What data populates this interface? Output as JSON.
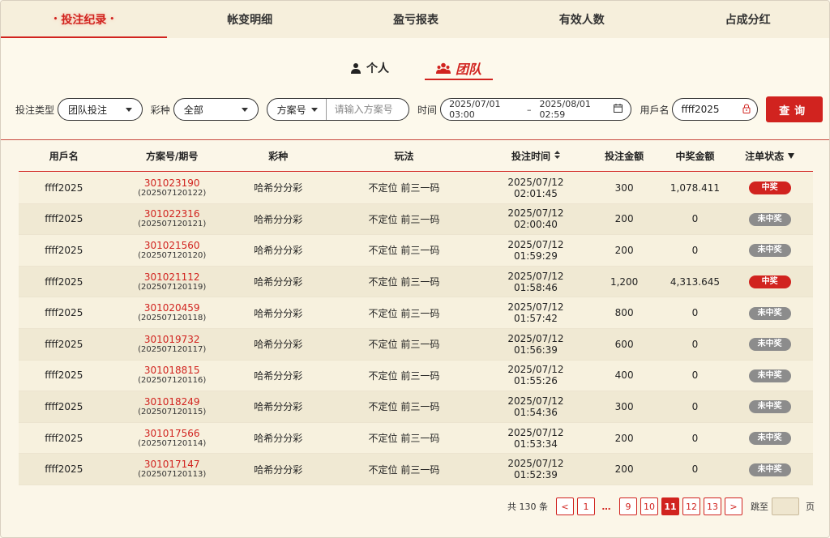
{
  "top_tabs": [
    {
      "label": "投注纪录",
      "active": true
    },
    {
      "label": "帐变明细",
      "active": false
    },
    {
      "label": "盈亏报表",
      "active": false
    },
    {
      "label": "有效人数",
      "active": false
    },
    {
      "label": "占成分红",
      "active": false
    }
  ],
  "sub_tabs": [
    {
      "label": "个人",
      "icon": "person-icon",
      "active": false
    },
    {
      "label": "团队",
      "icon": "team-icon",
      "active": true
    }
  ],
  "filters": {
    "bet_type_label": "投注类型",
    "bet_type_value": "团队投注",
    "lottery_label": "彩种",
    "lottery_value": "全部",
    "plan_select": "方案号",
    "plan_placeholder": "请输入方案号",
    "time_label": "时间",
    "date_start": "2025/07/01 03:00",
    "date_sep": "–",
    "date_end": "2025/08/01 02:59",
    "user_label": "用戶名",
    "user_value": "ffff2025",
    "query_button": "查询"
  },
  "table": {
    "headers": {
      "user": "用戶名",
      "plan": "方案号/期号",
      "lottery": "彩种",
      "play": "玩法",
      "time": "投注时间",
      "bet": "投注金额",
      "win": "中奖金额",
      "status": "注单状态"
    },
    "rows": [
      {
        "user": "ffff2025",
        "plan": "301023190",
        "issue": "(202507120122)",
        "lottery": "哈希分分彩",
        "play": "不定位 前三一码",
        "time": "2025/07/12 02:01:45",
        "bet": "300",
        "win": "1,078.411",
        "status": "中奖",
        "won": true
      },
      {
        "user": "ffff2025",
        "plan": "301022316",
        "issue": "(202507120121)",
        "lottery": "哈希分分彩",
        "play": "不定位 前三一码",
        "time": "2025/07/12 02:00:40",
        "bet": "200",
        "win": "0",
        "status": "未中奖",
        "won": false
      },
      {
        "user": "ffff2025",
        "plan": "301021560",
        "issue": "(202507120120)",
        "lottery": "哈希分分彩",
        "play": "不定位 前三一码",
        "time": "2025/07/12 01:59:29",
        "bet": "200",
        "win": "0",
        "status": "未中奖",
        "won": false
      },
      {
        "user": "ffff2025",
        "plan": "301021112",
        "issue": "(202507120119)",
        "lottery": "哈希分分彩",
        "play": "不定位 前三一码",
        "time": "2025/07/12 01:58:46",
        "bet": "1,200",
        "win": "4,313.645",
        "status": "中奖",
        "won": true
      },
      {
        "user": "ffff2025",
        "plan": "301020459",
        "issue": "(202507120118)",
        "lottery": "哈希分分彩",
        "play": "不定位 前三一码",
        "time": "2025/07/12 01:57:42",
        "bet": "800",
        "win": "0",
        "status": "未中奖",
        "won": false
      },
      {
        "user": "ffff2025",
        "plan": "301019732",
        "issue": "(202507120117)",
        "lottery": "哈希分分彩",
        "play": "不定位 前三一码",
        "time": "2025/07/12 01:56:39",
        "bet": "600",
        "win": "0",
        "status": "未中奖",
        "won": false
      },
      {
        "user": "ffff2025",
        "plan": "301018815",
        "issue": "(202507120116)",
        "lottery": "哈希分分彩",
        "play": "不定位 前三一码",
        "time": "2025/07/12 01:55:26",
        "bet": "400",
        "win": "0",
        "status": "未中奖",
        "won": false
      },
      {
        "user": "ffff2025",
        "plan": "301018249",
        "issue": "(202507120115)",
        "lottery": "哈希分分彩",
        "play": "不定位 前三一码",
        "time": "2025/07/12 01:54:36",
        "bet": "300",
        "win": "0",
        "status": "未中奖",
        "won": false
      },
      {
        "user": "ffff2025",
        "plan": "301017566",
        "issue": "(202507120114)",
        "lottery": "哈希分分彩",
        "play": "不定位 前三一码",
        "time": "2025/07/12 01:53:34",
        "bet": "200",
        "win": "0",
        "status": "未中奖",
        "won": false
      },
      {
        "user": "ffff2025",
        "plan": "301017147",
        "issue": "(202507120113)",
        "lottery": "哈希分分彩",
        "play": "不定位 前三一码",
        "time": "2025/07/12 01:52:39",
        "bet": "200",
        "win": "0",
        "status": "未中奖",
        "won": false
      }
    ]
  },
  "pagination": {
    "total_text": "共 130 条",
    "prev": "<",
    "next": ">",
    "pages": [
      "1",
      "…",
      "9",
      "10",
      "11",
      "12",
      "13"
    ],
    "current": "11",
    "jump_label": "跳至",
    "page_suffix": "页"
  },
  "colors": {
    "accent": "#d1231f",
    "lose_badge": "#8c8c8c",
    "background": "#fdf9ec"
  }
}
